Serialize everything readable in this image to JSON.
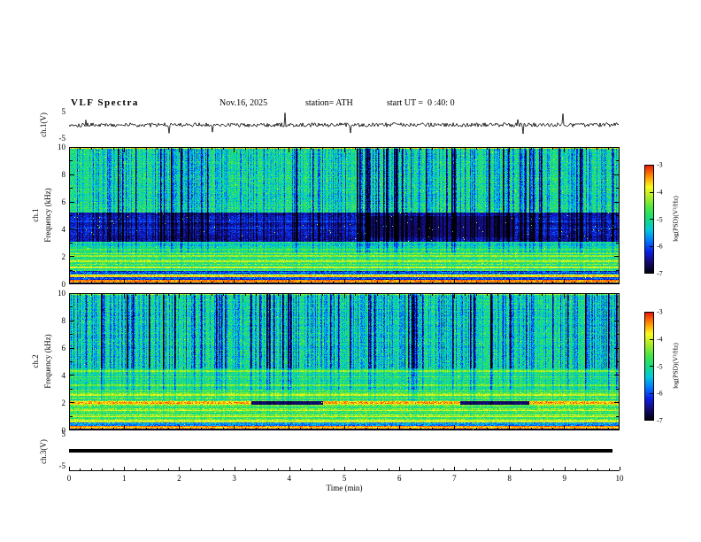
{
  "header": {
    "title": "VLF Spectra",
    "date": "Nov.16, 2025",
    "station": "station= ATH",
    "start_ut": "start UT =  0 :40: 0"
  },
  "xaxis": {
    "label": "Time (min)",
    "lim": [
      0,
      10
    ],
    "ticks": [
      0,
      1,
      2,
      3,
      4,
      5,
      6,
      7,
      8,
      9,
      10
    ]
  },
  "colorbar": {
    "label": "log(PSD)(V²/Hz)",
    "ticks": [
      -3,
      -4,
      -5,
      -6,
      -7
    ],
    "range": [
      -3,
      -7
    ]
  },
  "chart_data": [
    {
      "type": "line",
      "name": "ch1_waveform",
      "ylabel": "ch.1(V)",
      "ylim": [
        -5,
        5
      ],
      "yticks": [
        5,
        -5
      ],
      "xlim": [
        0,
        10
      ],
      "style": {
        "noise_amp": 0.7,
        "spike_prob": 0.015,
        "spike_max": 4.5,
        "seed": 101
      }
    },
    {
      "type": "heatmap",
      "name": "ch1_spectrogram",
      "row_label": "ch.1",
      "ylabel": "Frequency (kHz)",
      "ylim": [
        0,
        10
      ],
      "yticks": [
        0,
        2,
        4,
        6,
        8,
        10
      ],
      "xlim": [
        0,
        10
      ],
      "value_range": [
        -7,
        -3
      ],
      "seed": 7,
      "bands": [
        {
          "f": [
            0.0,
            0.12
          ],
          "base": -6.8,
          "noise": 0.2
        },
        {
          "f": [
            0.12,
            0.3
          ],
          "base": -3.4,
          "noise": 0.3
        },
        {
          "f": [
            0.3,
            0.5
          ],
          "base": -6.2,
          "noise": 0.4
        },
        {
          "f": [
            0.5,
            0.7
          ],
          "base": -3.9,
          "noise": 0.4
        },
        {
          "f": [
            0.7,
            0.95
          ],
          "base": -5.8,
          "noise": 0.5
        },
        {
          "f": [
            0.95,
            2.3
          ],
          "base": -4.7,
          "noise": 0.5
        },
        {
          "f": [
            2.3,
            3.1
          ],
          "base": -5.1,
          "noise": 0.45
        },
        {
          "f": [
            3.1,
            5.2
          ],
          "base": -6.25,
          "noise": 0.35
        },
        {
          "f": [
            5.2,
            10.01
          ],
          "base": -4.95,
          "noise": 0.5
        }
      ],
      "hlines": [
        {
          "f": 1.25,
          "v": -4.0
        },
        {
          "f": 1.7,
          "v": -4.1
        },
        {
          "f": 2.05,
          "v": -4.3
        },
        {
          "f": 2.5,
          "v": -4.6
        },
        {
          "f": 3.05,
          "v": -4.9
        },
        {
          "f": 4.1,
          "v": -5.9
        },
        {
          "f": 4.6,
          "v": -6.0
        },
        {
          "f": 9.93,
          "v": -3.6
        }
      ],
      "segments": [
        {
          "f": [
            3.4,
            5.0
          ],
          "x": [
            [
              5.4,
              8.1
            ]
          ],
          "v": -6.55
        }
      ],
      "streaks": {
        "density": 0.55,
        "strong_prob": 0.06
      },
      "streak_weights": [
        {
          "f": [
            0,
            2.3
          ],
          "w": 0.12
        },
        {
          "f": [
            2.3,
            3.1
          ],
          "w": 0.45
        },
        {
          "f": [
            3.1,
            5.2
          ],
          "w": 0.78
        },
        {
          "f": [
            5.2,
            10.01
          ],
          "w": 1.0
        }
      ]
    },
    {
      "type": "heatmap",
      "name": "ch2_spectrogram",
      "row_label": "ch.2",
      "ylabel": "Frequency (kHz)",
      "ylim": [
        0,
        10
      ],
      "yticks": [
        0,
        2,
        4,
        6,
        8,
        10
      ],
      "xlim": [
        0,
        10
      ],
      "value_range": [
        -7,
        -3
      ],
      "seed": 31,
      "bands": [
        {
          "f": [
            0.0,
            0.12
          ],
          "base": -6.7,
          "noise": 0.3
        },
        {
          "f": [
            0.12,
            0.3
          ],
          "base": -3.5,
          "noise": 0.3
        },
        {
          "f": [
            0.3,
            0.55
          ],
          "base": -5.6,
          "noise": 0.5
        },
        {
          "f": [
            0.55,
            0.75
          ],
          "base": -3.9,
          "noise": 0.4
        },
        {
          "f": [
            0.75,
            1.9
          ],
          "base": -4.5,
          "noise": 0.5
        },
        {
          "f": [
            1.9,
            2.15
          ],
          "base": -3.7,
          "noise": 0.4
        },
        {
          "f": [
            2.15,
            3.0
          ],
          "base": -4.6,
          "noise": 0.45
        },
        {
          "f": [
            3.0,
            4.5
          ],
          "base": -4.9,
          "noise": 0.45
        },
        {
          "f": [
            4.5,
            10.01
          ],
          "base": -5.0,
          "noise": 0.5
        }
      ],
      "hlines": [
        {
          "f": 1.0,
          "v": -3.9
        },
        {
          "f": 1.45,
          "v": -4.0
        },
        {
          "f": 2.6,
          "v": -4.0
        },
        {
          "f": 3.3,
          "v": -4.3
        },
        {
          "f": 3.9,
          "v": -4.4
        },
        {
          "f": 4.3,
          "v": -4.2
        },
        {
          "f": 9.93,
          "v": -4.2
        }
      ],
      "segments": [
        {
          "f": [
            1.9,
            2.15
          ],
          "x": [
            [
              3.3,
              4.6
            ],
            [
              7.1,
              8.35
            ]
          ],
          "v": -6.6
        }
      ],
      "streaks": {
        "density": 0.6,
        "strong_prob": 0.08
      },
      "streak_weights": [
        {
          "f": [
            0,
            2.15
          ],
          "w": 0.1
        },
        {
          "f": [
            2.15,
            3.0
          ],
          "w": 0.25
        },
        {
          "f": [
            3.0,
            4.5
          ],
          "w": 0.5
        },
        {
          "f": [
            4.5,
            10.01
          ],
          "w": 1.0
        }
      ]
    },
    {
      "type": "line",
      "name": "ch3_waveform",
      "ylabel": "ch.3(V)",
      "ylim": [
        -5,
        5
      ],
      "yticks": [
        5,
        -5
      ],
      "xlim": [
        0,
        10
      ],
      "flat_value": 0
    }
  ]
}
